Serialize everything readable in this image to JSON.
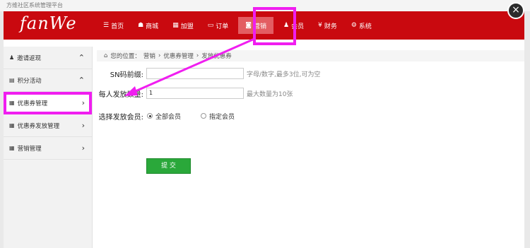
{
  "window": {
    "title": "方维社区系统管理平台",
    "close_label": "×"
  },
  "header": {
    "logo": "fanWe",
    "nav": [
      {
        "label": "首页",
        "icon": "list-icon",
        "glyph": "☰"
      },
      {
        "label": "商城",
        "icon": "shop-icon",
        "glyph": "☗"
      },
      {
        "label": "加盟",
        "icon": "grid-icon",
        "glyph": "▦"
      },
      {
        "label": "订单",
        "icon": "card-icon",
        "glyph": "▭"
      },
      {
        "label": "营销",
        "icon": "marketing-icon",
        "glyph": "◙"
      },
      {
        "label": "会员",
        "icon": "user-icon",
        "glyph": "♟"
      },
      {
        "label": "财务",
        "icon": "yen-icon",
        "glyph": "¥"
      },
      {
        "label": "系统",
        "icon": "gears-icon",
        "glyph": "⚙"
      }
    ],
    "active_index": 4
  },
  "sidebar": {
    "items": [
      {
        "label": "邀请返现",
        "glyph": "♟",
        "chevron": "⌃"
      },
      {
        "label": "积分活动",
        "glyph": "▤",
        "chevron": "⌃"
      },
      {
        "label": "优惠券管理",
        "glyph": "▦",
        "chevron": "›"
      },
      {
        "label": "优惠券发放管理",
        "glyph": "▦",
        "chevron": "›"
      },
      {
        "label": "营销管理",
        "glyph": "▦",
        "chevron": "›"
      }
    ],
    "highlighted_index": 2
  },
  "breadcrumb": {
    "home_glyph": "⌂",
    "prefix": "您的位置：",
    "items": [
      "营销",
      "优惠券管理",
      "发放优惠券"
    ],
    "separator": "›"
  },
  "form": {
    "sn_prefix": {
      "label": "SN码前缀:",
      "value": "",
      "hint": "字母/数字,最多3位,可为空"
    },
    "per_user_qty": {
      "label": "每人发放数量:",
      "value": "1",
      "hint": "最大数量为10张"
    },
    "members": {
      "label": "选择发放会员:",
      "options": [
        "全部会员",
        "指定会员"
      ],
      "selected_index": 0
    },
    "submit_label": "提 交"
  },
  "annotation_color": "#f01ef0"
}
